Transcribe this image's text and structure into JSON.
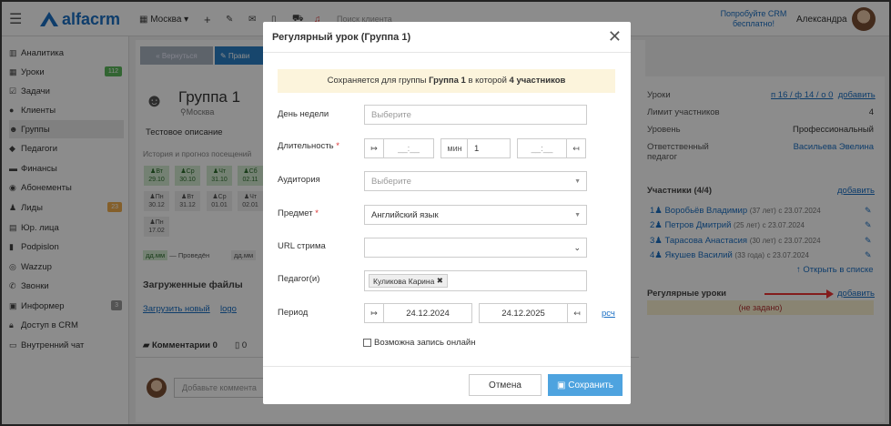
{
  "header": {
    "logo_text": "alfacrm",
    "branch": "Москва",
    "search_placeholder": "Поиск клиента",
    "promo": "Попробуйте CRM бесплатно!",
    "user_name": "Александра"
  },
  "sidebar": {
    "items": [
      {
        "label": "Аналитика",
        "icon": "chart-icon"
      },
      {
        "label": "Уроки",
        "icon": "table-icon",
        "badge": "112"
      },
      {
        "label": "Задачи",
        "icon": "tasks-icon"
      },
      {
        "label": "Клиенты",
        "icon": "user-icon"
      },
      {
        "label": "Группы",
        "icon": "users-icon"
      },
      {
        "label": "Педагоги",
        "icon": "graduation-icon"
      },
      {
        "label": "Финансы",
        "icon": "money-icon"
      },
      {
        "label": "Абонементы",
        "icon": "ticket-icon"
      },
      {
        "label": "Лиды",
        "icon": "lead-icon",
        "badge": "23"
      },
      {
        "label": "Юр. лица",
        "icon": "building-icon"
      },
      {
        "label": "Podpislon",
        "icon": "file-icon"
      },
      {
        "label": "Wazzup",
        "icon": "whatsapp-icon"
      },
      {
        "label": "Звонки",
        "icon": "phone-icon"
      },
      {
        "label": "Информер",
        "icon": "informer-icon",
        "badge": "3"
      },
      {
        "label": "Доступ в CRM",
        "icon": "lock-icon"
      },
      {
        "label": "Внутренний чат",
        "icon": "chat-icon"
      }
    ],
    "badge_colors": {
      "lessons": "#5cb85c",
      "leads": "#f0ad4e",
      "informer": "#999999"
    }
  },
  "group": {
    "back_label": "« Вернуться",
    "edit_label": "Прави",
    "title": "Группа 1",
    "city": "Москва",
    "description": "Тестовое описание",
    "history_label": "История и прогноз посещений",
    "calendar": [
      {
        "d": "Вт",
        "n": "29.10"
      },
      {
        "d": "Ср",
        "n": "30.10"
      },
      {
        "d": "Чт",
        "n": "31.10"
      },
      {
        "d": "Сб",
        "n": "02.11"
      },
      {
        "d": "Пн",
        "n": "30.12"
      },
      {
        "d": "Вт",
        "n": "31.12"
      },
      {
        "d": "Ср",
        "n": "01.01"
      },
      {
        "d": "Чт",
        "n": "02.01"
      },
      {
        "d": "Пн",
        "n": "17.02"
      }
    ],
    "legend_done_tag": "дд.мм",
    "legend_done": "— Проведён",
    "legend_plan_tag": "дд.мм",
    "files_title": "Загруженные файлы",
    "upload_label": "Загрузить новый",
    "logo_file": "logo",
    "comments_tab": "Комментарии 0",
    "second_tab": "0",
    "comment_placeholder": "Добавьте коммента"
  },
  "right": {
    "lessons_label": "Уроки",
    "lessons_value": "п 16 / ф 14 / о 0",
    "add": "добавить",
    "limit_label": "Лимит участников",
    "limit_value": "4",
    "level_label": "Уровень",
    "level_value": "Профессиональный",
    "teacher_label": "Ответственный педагог",
    "teacher_value": "Васильева Эвелина",
    "participants_title": "Участники (4/4)",
    "participants": [
      {
        "n": "1",
        "name": "Воробьёв Владимир",
        "age": "(37 лет)",
        "since": "с 23.07.2024"
      },
      {
        "n": "2",
        "name": "Петров Дмитрий",
        "age": "(25 лет)",
        "since": "с 23.07.2024"
      },
      {
        "n": "3",
        "name": "Тарасова Анастасия",
        "age": "(30 лет)",
        "since": "с 23.07.2024"
      },
      {
        "n": "4",
        "name": "Якушев Василий",
        "age": "(33 года)",
        "since": "с 23.07.2024"
      }
    ],
    "open_list": "Открыть в списке",
    "regular_title": "Регулярные уроки",
    "regular_add": "добавить",
    "not_set": "(не задано)"
  },
  "modal": {
    "title": "Регулярный урок (Группа 1)",
    "notice_prefix": "Сохраняется для группы ",
    "notice_group": "Группа 1",
    "notice_mid": " в которой ",
    "notice_count": "4 участников",
    "weekday_label": "День недели",
    "weekday_placeholder": "Выберите",
    "duration_label": "Длительность",
    "time_start_placeholder": "__:__",
    "min_label": "мин",
    "min_value": "1",
    "time_end_placeholder": "__:__",
    "room_label": "Аудитория",
    "room_placeholder": "Выберите",
    "subject_label": "Предмет",
    "subject_value": "Английский язык",
    "stream_label": "URL стрима",
    "teacher_label": "Педагог(и)",
    "teacher_tag": "Куликова Карина",
    "period_label": "Период",
    "period_from": "24.12.2024",
    "period_to": "24.12.2025",
    "period_link": "рсч",
    "online_label": "Возможна запись онлайн",
    "cancel": "Отмена",
    "save": "Сохранить"
  }
}
